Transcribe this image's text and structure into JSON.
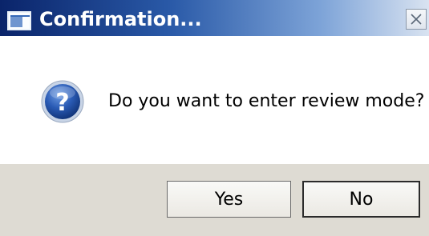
{
  "window": {
    "title": "Confirmation...",
    "title_icon": "application-window-icon",
    "close_icon": "close-icon"
  },
  "message": {
    "icon": "question-icon",
    "text": "Do you want to enter review mode?"
  },
  "buttons": {
    "yes_label": "Yes",
    "no_label": "No"
  },
  "colors": {
    "titlebar_start": "#0a246a",
    "titlebar_end": "#d9e3f1",
    "button_area": "#dedbd3",
    "icon_blue": "#1e4fa0"
  }
}
